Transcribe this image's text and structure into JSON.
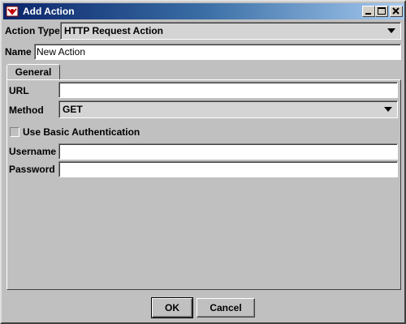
{
  "window": {
    "title": "Add Action",
    "controls": {
      "minimize": "minimize-icon",
      "maximize": "maximize-icon",
      "close": "close-icon"
    }
  },
  "form": {
    "action_type_label": "Action Type",
    "action_type_value": "HTTP Request Action",
    "name_label": "Name",
    "name_value": "New Action"
  },
  "tabs": [
    {
      "label": "General"
    }
  ],
  "general": {
    "url_label": "URL",
    "url_value": "",
    "method_label": "Method",
    "method_value": "GET",
    "basic_auth_label": "Use Basic Authentication",
    "basic_auth_checked": false,
    "username_label": "Username",
    "username_value": "",
    "password_label": "Password",
    "password_value": ""
  },
  "buttons": {
    "ok": "OK",
    "cancel": "Cancel"
  }
}
